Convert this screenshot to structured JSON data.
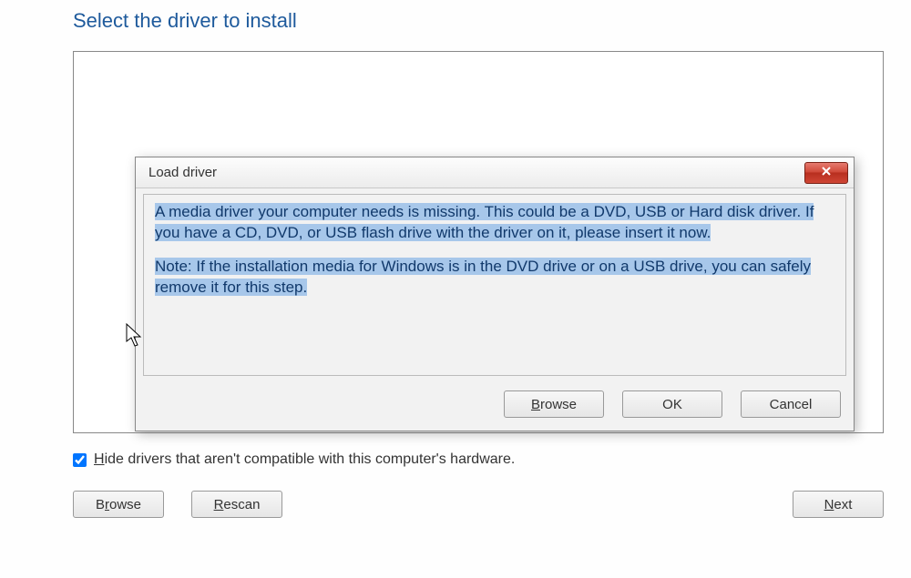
{
  "main": {
    "title": "Select the driver to install",
    "hide_checkbox_checked": true,
    "hide_checkbox_label_pre": "H",
    "hide_checkbox_label_post": "ide drivers that aren't compatible with this computer's hardware.",
    "buttons": {
      "browse_pre": "B",
      "browse_u": "r",
      "browse_post": "owse",
      "rescan_pre": "",
      "rescan_u": "R",
      "rescan_post": "escan",
      "next_pre": "",
      "next_u": "N",
      "next_post": "ext"
    }
  },
  "dialog": {
    "title": "Load driver",
    "message1": "A media driver your computer needs is missing. This could be a DVD, USB or Hard disk driver. If you have a CD, DVD, or USB flash drive with the driver on it, please insert it now.",
    "message2": "Note: If the installation media for Windows is in the DVD drive or on a USB drive, you can safely remove it for this step.",
    "buttons": {
      "browse_pre": "",
      "browse_u": "B",
      "browse_post": "rowse",
      "ok": "OK",
      "cancel": "Cancel"
    }
  }
}
